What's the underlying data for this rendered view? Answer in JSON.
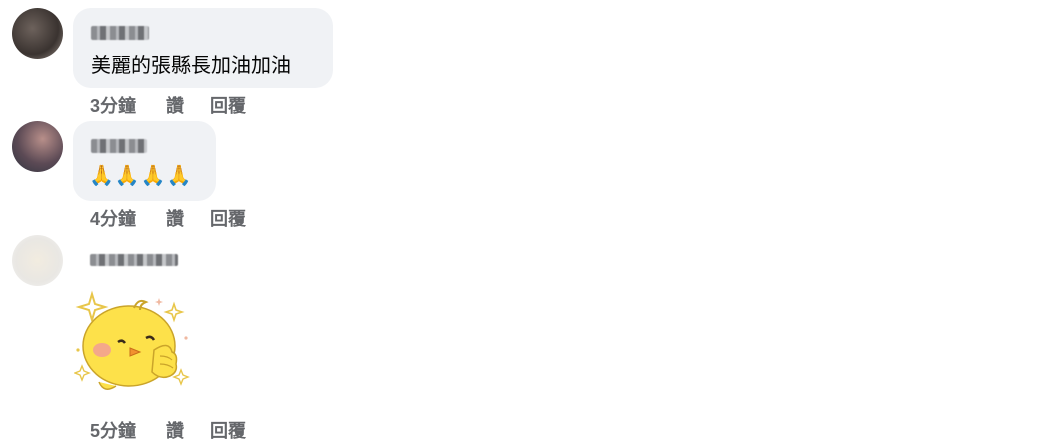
{
  "comments": [
    {
      "text": "美麗的張縣長加油加油",
      "time": "3分鐘",
      "like": "讚",
      "reply": "回覆"
    },
    {
      "text": "🙏🙏🙏🙏",
      "time": "4分鐘",
      "like": "讚",
      "reply": "回覆"
    },
    {
      "sticker": "chick-thumbs-up-sticker",
      "time": "5分鐘",
      "like": "讚",
      "reply": "回覆"
    }
  ],
  "colors": {
    "bubble": "#f0f2f5",
    "action_text": "#65676b",
    "text": "#050505"
  }
}
